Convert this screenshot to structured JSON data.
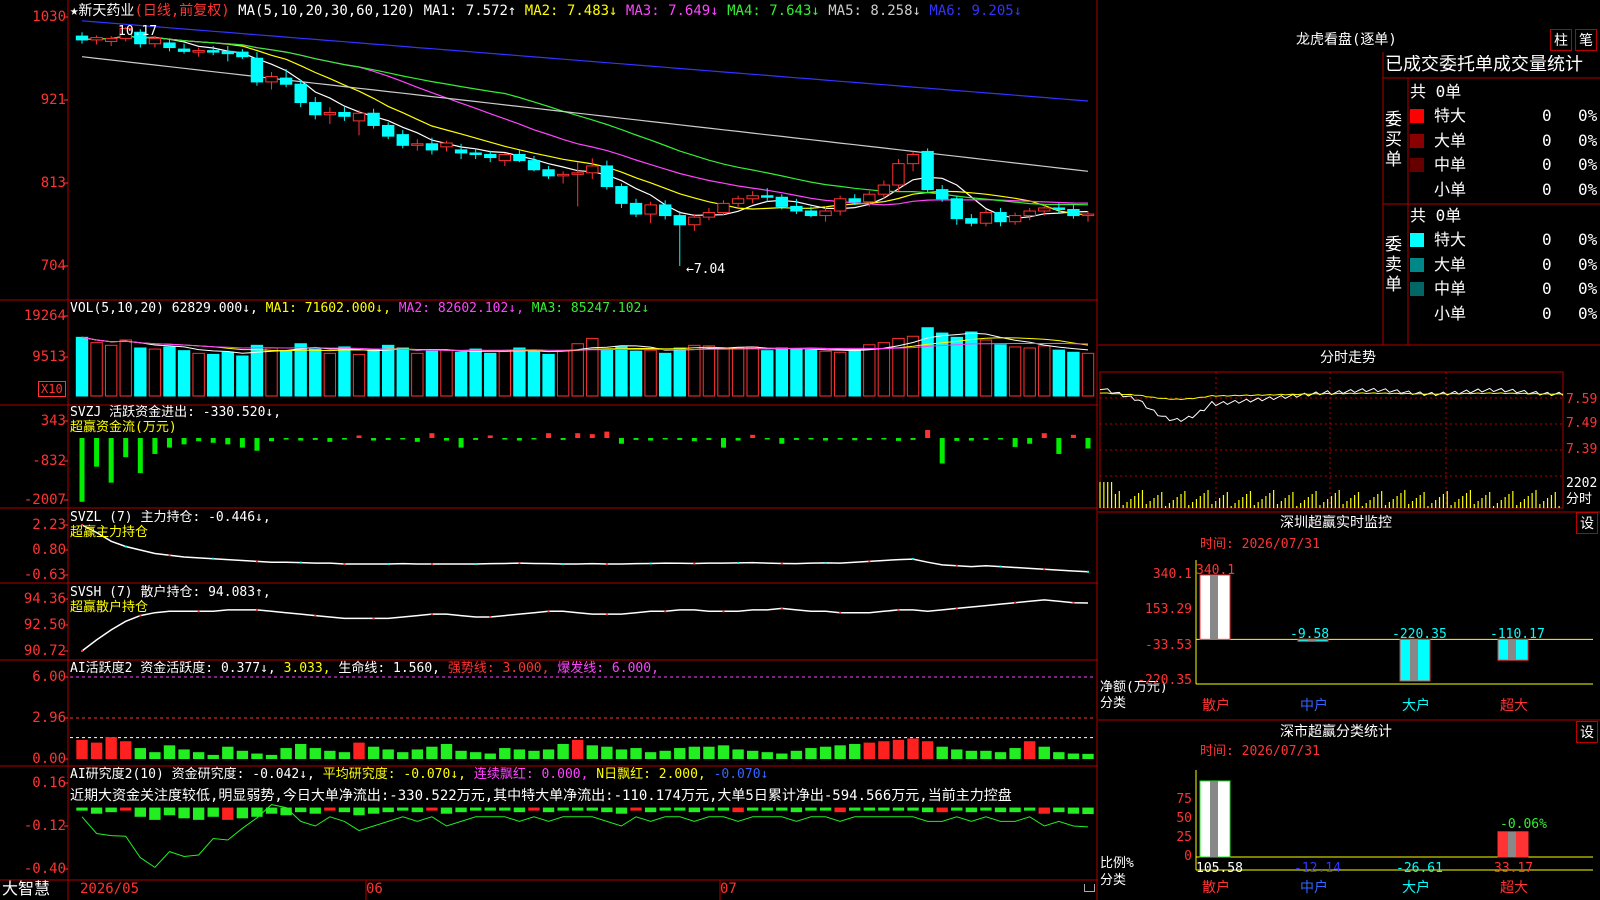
{
  "header": {
    "stock_name": "★新天药业",
    "period": "(日线,前复权)",
    "ma_params": "MA(5,10,20,30,60,120)",
    "ma": [
      {
        "label": "MA1: 7.572↑",
        "color": "#ffffff"
      },
      {
        "label": "MA2: 7.483↓",
        "color": "#ffff00"
      },
      {
        "label": "MA3: 7.649↓",
        "color": "#ff44ff"
      },
      {
        "label": "MA4: 7.643↓",
        "color": "#33ee33"
      },
      {
        "label": "MA5: 8.258↓",
        "color": "#cccccc"
      },
      {
        "label": "MA6: 9.205↓",
        "color": "#3333ff"
      }
    ]
  },
  "price_axis": [
    "1030",
    "921",
    "813",
    "704"
  ],
  "price_high_label": "10.17",
  "price_low_label": "←7.04",
  "vol": {
    "title": "VOL(5,10,20)",
    "value": "62829.000↓,",
    "ma1": "MA1: 71602.000↓,",
    "ma2": "MA2: 82602.102↓,",
    "ma3": "MA3: 85247.102↓",
    "axis": [
      "19264",
      "9513"
    ],
    "unit": "X10"
  },
  "svzj": {
    "title": "SVZJ  活跃资金进出: -330.520↓,",
    "sub": "超赢资金流(万元)",
    "axis": [
      "343",
      "-832",
      "-2007"
    ]
  },
  "svzl": {
    "title": "SVZL (7) 主力持仓: -0.446↓,",
    "sub": "超赢主力持仓",
    "axis": [
      "2.23",
      "0.80",
      "-0.63"
    ]
  },
  "svsh": {
    "title": "SVSH (7) 散户持仓: 94.083↑,",
    "sub": "超赢散户持仓",
    "axis": [
      "94.36",
      "92.50",
      "90.72"
    ]
  },
  "ai1": {
    "title": "AI活跃度2 资金活跃度: 0.377↓,",
    "v2": "3.033,",
    "life": "生命线: 1.560,",
    "strong": "强势线: 3.000,",
    "burst": "爆发线: 6.000,",
    "axis": [
      "6.00",
      "2.96",
      "0.00"
    ]
  },
  "ai2": {
    "title": "AI研究度2(10) 资金研究度: -0.042↓,",
    "avg": "平均研究度: -0.070↓,",
    "cont": "连续飘红: 0.000,",
    "nday": "N日飘红: 2.000,",
    "last": "-0.070↓",
    "commentary": "近期大资金关注度较低,明显弱势,今日大单净流出:-330.522万元,其中特大单净流出:-110.174万元,大单5日累计净出-594.566万元,当前主力控盘",
    "axis": [
      "0.16",
      "-0.12",
      "-0.40"
    ]
  },
  "date_axis": [
    "2026/05",
    "06",
    "07"
  ],
  "brand": "大智慧",
  "right": {
    "lh_title": "龙虎看盘(逐单)",
    "btn1": "柱",
    "btn2": "笔",
    "stats_title": "已成交委托单成交量统计",
    "buy_label": "委买单",
    "sell_label": "委卖单",
    "buy_total": "共 0单",
    "sell_total": "共 0单",
    "buy_rows": [
      {
        "name": "特大",
        "vol": "0",
        "pct": "0%",
        "color": "#ff0000"
      },
      {
        "name": "大单",
        "vol": "0",
        "pct": "0%",
        "color": "#880000"
      },
      {
        "name": "中单",
        "vol": "0",
        "pct": "0%",
        "color": "#660000"
      },
      {
        "name": "小单",
        "vol": "0",
        "pct": "0%",
        "color": "#000000"
      }
    ],
    "sell_rows": [
      {
        "name": "特大",
        "vol": "0",
        "pct": "0%",
        "color": "#00ffff"
      },
      {
        "name": "大单",
        "vol": "0",
        "pct": "0%",
        "color": "#008888"
      },
      {
        "name": "中单",
        "vol": "0",
        "pct": "0%",
        "color": "#006666"
      },
      {
        "name": "小单",
        "vol": "0",
        "pct": "0%",
        "color": "#000000"
      }
    ],
    "fs_title": "分时走势",
    "fs_axis": [
      "7.59",
      "7.49",
      "7.39"
    ],
    "fs_vol": "2202",
    "fs_unit": "分时",
    "mon_title": "深圳超赢实时监控",
    "mon_btn": "设",
    "mon_time": "时间: 2026/07/31",
    "mon_axis": [
      "340.1",
      "153.29",
      "-33.53",
      "-220.35"
    ],
    "mon_ylabel": "净额(万元)",
    "mon_xlabel": "分类",
    "mon_bars": [
      {
        "cat": "散户",
        "value": 340.1,
        "label": "340.1",
        "color": "#ffffff"
      },
      {
        "cat": "中户",
        "value": -9.58,
        "label": "-9.58",
        "color": "#00ffff"
      },
      {
        "cat": "大户",
        "value": -220.35,
        "label": "-220.35",
        "color": "#00ffff"
      },
      {
        "cat": "超大",
        "value": -110.17,
        "label": "-110.17",
        "color": "#00ffff"
      }
    ],
    "cls_title": "深市超赢分类统计",
    "cls_btn": "设",
    "cls_time": "时间: 2026/07/31",
    "cls_axis": [
      "75",
      "50",
      "25",
      "0"
    ],
    "cls_ylabel": "比例%",
    "cls_xlabel": "分类",
    "cls_extra": "-0.06%",
    "cls_bars": [
      {
        "cat": "散户",
        "value": 105.58,
        "label": "105.58",
        "color": "#ffffff"
      },
      {
        "cat": "中户",
        "value": -12.14,
        "label": "-12.14",
        "color": "#3333ff"
      },
      {
        "cat": "大户",
        "value": -26.61,
        "label": "-26.61",
        "color": "#00ffff"
      },
      {
        "cat": "超大",
        "value": 33.17,
        "label": "33.17",
        "color": "#ff3333"
      }
    ]
  },
  "chart_data": [
    {
      "type": "candlestick",
      "name": "新天药业",
      "x_ticks": [
        "2026/05",
        "06",
        "07"
      ],
      "ylim": [
        7.04,
        10.3
      ],
      "high": 10.17,
      "low": 7.04,
      "ohlc": [
        [
          10.05,
          10.1,
          9.95,
          10.0
        ],
        [
          10.0,
          10.06,
          9.94,
          10.03
        ],
        [
          9.98,
          10.05,
          9.92,
          10.02
        ],
        [
          10.02,
          10.17,
          9.98,
          10.15
        ],
        [
          10.1,
          10.14,
          9.9,
          9.95
        ],
        [
          9.95,
          10.05,
          9.9,
          10.02
        ],
        [
          9.96,
          10.02,
          9.85,
          9.9
        ],
        [
          9.88,
          9.95,
          9.82,
          9.85
        ],
        [
          9.84,
          9.9,
          9.78,
          9.86
        ],
        [
          9.86,
          9.92,
          9.8,
          9.84
        ],
        [
          9.85,
          9.92,
          9.72,
          9.82
        ],
        [
          9.84,
          9.88,
          9.75,
          9.78
        ],
        [
          9.76,
          9.84,
          9.4,
          9.45
        ],
        [
          9.45,
          9.58,
          9.35,
          9.52
        ],
        [
          9.5,
          9.62,
          9.38,
          9.42
        ],
        [
          9.42,
          9.48,
          9.12,
          9.18
        ],
        [
          9.18,
          9.25,
          8.96,
          9.02
        ],
        [
          9.02,
          9.12,
          8.9,
          9.05
        ],
        [
          9.05,
          9.12,
          8.94,
          9.0
        ],
        [
          8.94,
          9.08,
          8.75,
          9.04
        ],
        [
          9.04,
          9.1,
          8.84,
          8.88
        ],
        [
          8.88,
          8.92,
          8.7,
          8.74
        ],
        [
          8.76,
          8.82,
          8.58,
          8.62
        ],
        [
          8.62,
          8.7,
          8.55,
          8.64
        ],
        [
          8.64,
          8.72,
          8.5,
          8.56
        ],
        [
          8.6,
          8.68,
          8.54,
          8.65
        ],
        [
          8.56,
          8.64,
          8.44,
          8.52
        ],
        [
          8.52,
          8.58,
          8.44,
          8.5
        ],
        [
          8.5,
          8.55,
          8.4,
          8.46
        ],
        [
          8.42,
          8.52,
          8.35,
          8.5
        ],
        [
          8.5,
          8.56,
          8.4,
          8.42
        ],
        [
          8.42,
          8.48,
          8.28,
          8.3
        ],
        [
          8.3,
          8.35,
          8.18,
          8.22
        ],
        [
          8.22,
          8.28,
          8.12,
          8.24
        ],
        [
          8.24,
          8.4,
          7.82,
          8.26
        ],
        [
          8.26,
          8.45,
          8.18,
          8.35
        ],
        [
          8.35,
          8.42,
          8.04,
          8.08
        ],
        [
          8.08,
          8.12,
          7.8,
          7.86
        ],
        [
          7.86,
          7.92,
          7.68,
          7.72
        ],
        [
          7.72,
          7.88,
          7.6,
          7.84
        ],
        [
          7.84,
          7.9,
          7.65,
          7.7
        ],
        [
          7.7,
          7.76,
          7.04,
          7.58
        ],
        [
          7.58,
          7.72,
          7.5,
          7.68
        ],
        [
          7.68,
          7.8,
          7.64,
          7.74
        ],
        [
          7.74,
          7.9,
          7.7,
          7.86
        ],
        [
          7.86,
          7.96,
          7.8,
          7.92
        ],
        [
          7.92,
          8.02,
          7.86,
          7.96
        ],
        [
          7.96,
          8.06,
          7.88,
          7.94
        ],
        [
          7.94,
          7.98,
          7.78,
          7.82
        ],
        [
          7.82,
          7.92,
          7.72,
          7.76
        ],
        [
          7.76,
          7.82,
          7.68,
          7.7
        ],
        [
          7.7,
          7.82,
          7.62,
          7.76
        ],
        [
          7.76,
          7.96,
          7.7,
          7.92
        ],
        [
          7.92,
          7.98,
          7.84,
          7.88
        ],
        [
          7.88,
          8.02,
          7.82,
          7.98
        ],
        [
          7.98,
          8.16,
          7.92,
          8.1
        ],
        [
          8.1,
          8.44,
          8.02,
          8.38
        ],
        [
          8.38,
          8.54,
          8.28,
          8.5
        ],
        [
          8.54,
          8.58,
          8.0,
          8.04
        ],
        [
          8.04,
          8.1,
          7.88,
          7.92
        ],
        [
          7.92,
          7.96,
          7.58,
          7.66
        ],
        [
          7.66,
          7.72,
          7.56,
          7.6
        ],
        [
          7.6,
          7.78,
          7.56,
          7.74
        ],
        [
          7.74,
          7.8,
          7.56,
          7.62
        ],
        [
          7.62,
          7.74,
          7.58,
          7.7
        ],
        [
          7.7,
          7.8,
          7.64,
          7.76
        ],
        [
          7.76,
          7.84,
          7.7,
          7.8
        ],
        [
          7.8,
          7.86,
          7.72,
          7.78
        ],
        [
          7.78,
          7.84,
          7.66,
          7.7
        ],
        [
          7.7,
          7.76,
          7.62,
          7.72
        ]
      ]
    },
    {
      "type": "bar",
      "name": "VOL",
      "values": [
        110,
        100,
        95,
        105,
        90,
        88,
        92,
        85,
        80,
        78,
        82,
        75,
        95,
        90,
        85,
        98,
        88,
        80,
        92,
        78,
        86,
        95,
        90,
        80,
        84,
        86,
        82,
        88,
        80,
        84,
        90,
        84,
        78,
        85,
        98,
        108,
        88,
        92,
        84,
        86,
        80,
        90,
        95,
        94,
        88,
        90,
        92,
        85,
        90,
        88,
        86,
        84,
        82,
        86,
        96,
        100,
        108,
        112,
        128,
        118,
        110,
        120,
        105,
        96,
        92,
        90,
        94,
        86,
        82,
        80
      ]
    },
    {
      "type": "bar",
      "name": "SVZJ",
      "values": [
        -2000,
        -900,
        -1400,
        -600,
        -1100,
        -500,
        -300,
        -200,
        -100,
        -150,
        -200,
        -300,
        -400,
        -100,
        -50,
        -80,
        -60,
        -120,
        -50,
        80,
        -80,
        -60,
        -40,
        -120,
        150,
        -80,
        -300,
        -60,
        80,
        -50,
        -80,
        -40,
        150,
        -60,
        150,
        120,
        200,
        -180,
        -60,
        -80,
        -40,
        -60,
        -100,
        -60,
        -300,
        -80,
        100,
        -40,
        -180,
        -60,
        -40,
        -80,
        -50,
        -70,
        -60,
        -40,
        -90,
        -60,
        250,
        -800,
        -90,
        -80,
        -60,
        -40,
        -280,
        -180,
        150,
        -500,
        100,
        -330
      ]
    },
    {
      "type": "line",
      "name": "SVZL",
      "ylim": [
        -0.63,
        2.23
      ],
      "values": [
        2.23,
        1.8,
        1.3,
        1.0,
        0.8,
        0.6,
        0.5,
        0.4,
        0.35,
        0.3,
        0.25,
        0.2,
        0.15,
        0.1,
        0.1,
        0.08,
        0.05,
        0.05,
        0.0,
        0.0,
        0.0,
        0.0,
        0.02,
        0.0,
        0.0,
        0.0,
        0.0,
        0.0,
        0.02,
        0.03,
        0.05,
        0.03,
        0.02,
        0.0,
        0.0,
        0.02,
        0.0,
        0.0,
        0.02,
        0.03,
        0.05,
        0.04,
        0.03,
        0.05,
        0.05,
        0.06,
        0.08,
        0.05,
        0.03,
        0.02,
        0.05,
        0.06,
        0.05,
        0.1,
        0.15,
        0.2,
        0.25,
        0.28,
        0.1,
        -0.05,
        -0.1,
        -0.15,
        -0.1,
        -0.15,
        -0.2,
        -0.25,
        -0.3,
        -0.35,
        -0.4,
        -0.446
      ]
    },
    {
      "type": "line",
      "name": "SVSH",
      "ylim": [
        90.72,
        94.36
      ],
      "values": [
        90.72,
        91.5,
        92.2,
        92.8,
        93.2,
        93.4,
        93.5,
        93.5,
        93.5,
        93.5,
        93.6,
        93.6,
        93.6,
        93.5,
        93.4,
        93.3,
        93.2,
        93.1,
        93.0,
        93.0,
        93.0,
        93.0,
        93.1,
        93.2,
        93.3,
        93.3,
        93.2,
        93.1,
        93.1,
        93.2,
        93.3,
        93.4,
        93.5,
        93.5,
        93.4,
        93.3,
        93.3,
        93.3,
        93.4,
        93.5,
        93.5,
        93.6,
        93.6,
        93.5,
        93.5,
        93.5,
        93.6,
        93.6,
        93.7,
        93.6,
        93.5,
        93.5,
        93.4,
        93.4,
        93.4,
        93.5,
        93.6,
        93.6,
        93.5,
        93.6,
        93.7,
        93.8,
        93.9,
        94.0,
        94.1,
        94.2,
        94.3,
        94.2,
        94.1,
        94.083
      ]
    },
    {
      "type": "bar",
      "name": "AI活跃度2",
      "ylim": [
        0,
        6
      ],
      "values": [
        1.4,
        1.2,
        1.6,
        1.3,
        0.8,
        0.5,
        1.0,
        0.7,
        0.5,
        0.3,
        0.9,
        0.6,
        0.4,
        0.3,
        0.8,
        1.1,
        0.8,
        0.6,
        0.5,
        1.2,
        0.9,
        0.7,
        0.5,
        0.7,
        0.9,
        1.1,
        0.6,
        0.5,
        0.4,
        0.8,
        0.7,
        0.6,
        0.7,
        1.1,
        1.4,
        1.0,
        0.9,
        0.7,
        0.8,
        0.5,
        0.6,
        0.8,
        0.9,
        0.9,
        1.0,
        0.7,
        0.6,
        0.5,
        0.4,
        0.6,
        0.8,
        0.9,
        1.0,
        1.1,
        1.2,
        1.3,
        1.4,
        1.5,
        1.3,
        0.9,
        0.7,
        0.6,
        0.6,
        0.5,
        0.8,
        1.3,
        0.9,
        0.5,
        0.4,
        0.377
      ]
    },
    {
      "type": "bar",
      "name": "AI研究度2",
      "ylim": [
        -0.4,
        0.16
      ],
      "values": [
        -0.02,
        -0.04,
        -0.03,
        -0.02,
        -0.06,
        -0.08,
        -0.05,
        -0.07,
        -0.08,
        -0.06,
        -0.08,
        -0.07,
        -0.06,
        -0.04,
        -0.05,
        -0.03,
        -0.04,
        -0.02,
        -0.03,
        -0.05,
        -0.04,
        -0.03,
        -0.02,
        -0.03,
        -0.02,
        -0.04,
        -0.03,
        -0.02,
        -0.02,
        -0.02,
        -0.03,
        -0.02,
        -0.03,
        -0.02,
        -0.02,
        -0.02,
        -0.03,
        -0.04,
        -0.02,
        -0.03,
        -0.02,
        -0.02,
        -0.03,
        -0.02,
        -0.02,
        -0.03,
        -0.02,
        -0.02,
        -0.02,
        -0.03,
        -0.02,
        -0.02,
        -0.03,
        -0.02,
        -0.02,
        -0.02,
        -0.02,
        -0.02,
        -0.03,
        -0.03,
        -0.02,
        -0.03,
        -0.02,
        -0.03,
        -0.03,
        -0.02,
        -0.04,
        -0.03,
        -0.04,
        -0.042
      ]
    }
  ]
}
